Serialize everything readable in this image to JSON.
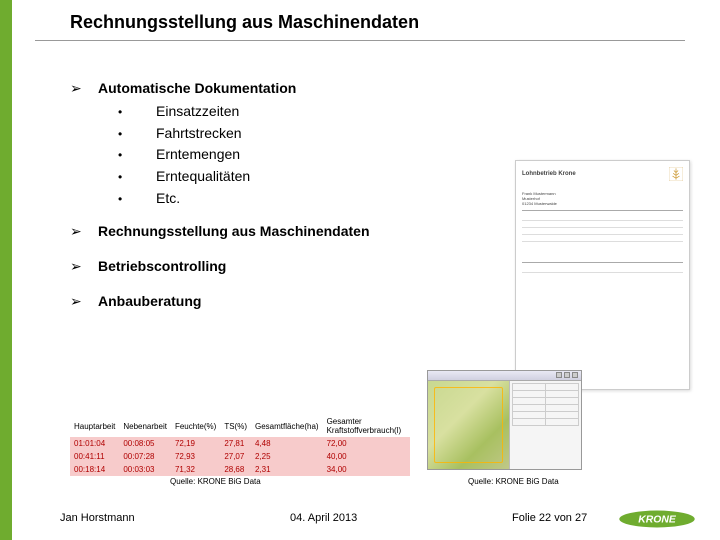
{
  "title": "Rechnungsstellung aus Maschinendaten",
  "main_bullets": {
    "b1": "Automatische Dokumentation",
    "b1_subs": {
      "s1": "Einsatzzeiten",
      "s2": "Fahrtstrecken",
      "s3": "Erntemengen",
      "s4": "Erntequalitäten",
      "s5": "Etc."
    },
    "b2": "Rechnungsstellung aus Maschinendaten",
    "b3": "Betriebscontrolling",
    "b4": "Anbauberatung"
  },
  "doc_thumb": {
    "title": "Lohnbetrieb Krone",
    "lines": [
      "Frank Mustermann",
      "Musterhof",
      "01234 Musterwalde"
    ]
  },
  "pink_table": {
    "head": {
      "c1": "Hauptarbeit",
      "c2": "Nebenarbeit",
      "c3": "Feuchte(%)",
      "c4": "TS(%)",
      "c5": "Gesamtfläche(ha)",
      "c6": "Gesamter Kraftstoffverbrauch(l)"
    },
    "r1": {
      "c1": "01:01:04",
      "c2": "00:08:05",
      "c3": "72,19",
      "c4": "27,81",
      "c5": "4,48",
      "c6": "72,00"
    },
    "r2": {
      "c1": "00:41:11",
      "c2": "00:07:28",
      "c3": "72,93",
      "c4": "27,07",
      "c5": "2,25",
      "c6": "40,00"
    },
    "r3": {
      "c1": "00:18:14",
      "c2": "00:03:03",
      "c3": "71,32",
      "c4": "28,68",
      "c5": "2,31",
      "c6": "34,00"
    }
  },
  "source": "Quelle: KRONE BiG Data",
  "footer": {
    "author": "Jan Horstmann",
    "date": "04. April 2013",
    "page": "Folie 22 von 27",
    "brand": "KRONE"
  }
}
